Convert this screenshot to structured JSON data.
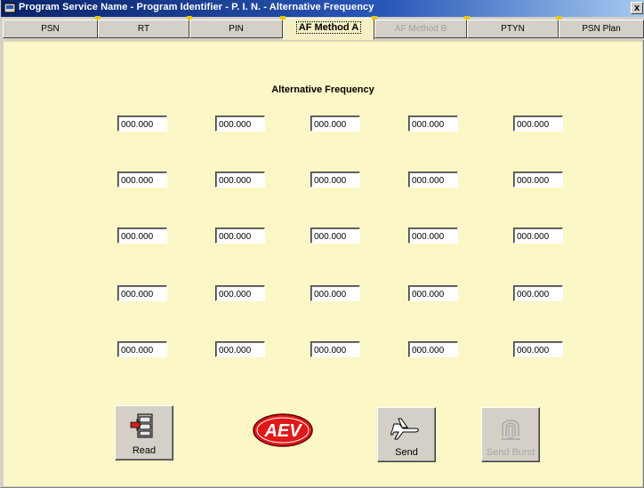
{
  "window": {
    "title": "Program Service Name - Program Identifier - P. I. N. - Alternative Frequency",
    "close_label": "x"
  },
  "tabs": [
    {
      "label": "PSN"
    },
    {
      "label": "RT"
    },
    {
      "label": "PIN"
    },
    {
      "label": "AF Method A"
    },
    {
      "label": "AF Method B"
    },
    {
      "label": "PTYN"
    },
    {
      "label": "PSN Plan"
    }
  ],
  "panel": {
    "heading": "Alternative Frequency",
    "frequencies": [
      [
        "000.000",
        "000.000",
        "000.000",
        "000.000",
        "000.000"
      ],
      [
        "000.000",
        "000.000",
        "000.000",
        "000.000",
        "000.000"
      ],
      [
        "000.000",
        "000.000",
        "000.000",
        "000.000",
        "000.000"
      ],
      [
        "000.000",
        "000.000",
        "000.000",
        "000.000",
        "000.000"
      ],
      [
        "000.000",
        "000.000",
        "000.000",
        "000.000",
        "000.000"
      ]
    ]
  },
  "buttons": {
    "read": "Read",
    "send": "Send",
    "send_burst": "Send Burst"
  },
  "logo": {
    "text": "AEV"
  },
  "colors": {
    "panel": "#fbf7c6",
    "titlebar": "#0a246a",
    "logo_red": "#e01818"
  }
}
